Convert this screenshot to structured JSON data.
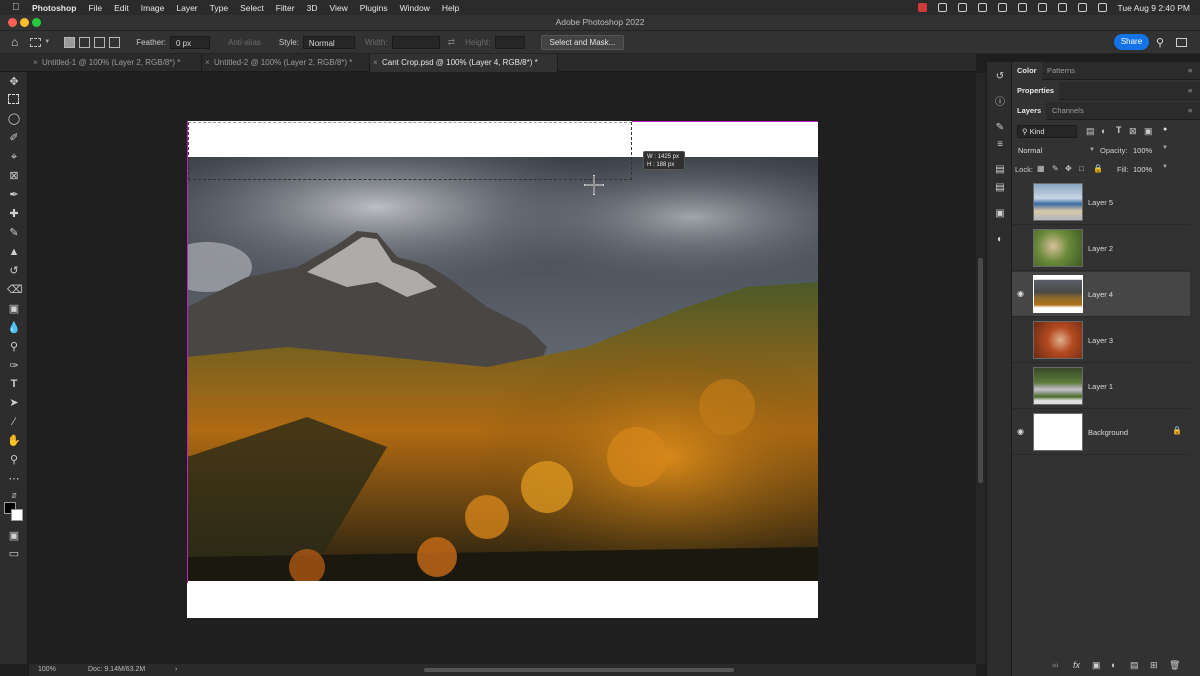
{
  "menubar": {
    "app": "Photoshop",
    "items": [
      "File",
      "Edit",
      "Image",
      "Layer",
      "Type",
      "Select",
      "Filter",
      "3D",
      "View",
      "Plugins",
      "Window",
      "Help"
    ],
    "clock": "Tue Aug 9  2:40 PM"
  },
  "window": {
    "title": "Adobe Photoshop 2022"
  },
  "options": {
    "feather_label": "Feather:",
    "feather_value": "0 px",
    "antialias_label": "Anti-alias",
    "style_label": "Style:",
    "style_value": "Normal",
    "width_label": "Width:",
    "height_label": "Height:",
    "mask_button": "Select and Mask...",
    "share_button": "Share"
  },
  "tabs": [
    {
      "label": "Untitled-1 @ 100% (Layer 2, RGB/8*) *",
      "active": false
    },
    {
      "label": "Untitled-2 @ 100% (Layer 2, RGB/8*) *",
      "active": false
    },
    {
      "label": "Cant Crop.psd @ 100% (Layer 4, RGB/8*) *",
      "active": true
    }
  ],
  "selection_readout": {
    "w": "W : 1425 px",
    "h": "H :  188 px"
  },
  "status": {
    "zoom": "100%",
    "doc": "Doc: 9.14M/63.2M",
    "arrow": "›"
  },
  "panels": {
    "color_tabs": [
      "Color",
      "Patterns"
    ],
    "properties_tab": "Properties",
    "layers_tabs": [
      "Layers",
      "Channels"
    ],
    "filter_kind": "Kind",
    "blend_mode": "Normal",
    "opacity_label": "Opacity:",
    "opacity_value": "100%",
    "lock_label": "Lock:",
    "fill_label": "Fill:",
    "fill_value": "100%"
  },
  "layers": [
    {
      "name": "Layer 5",
      "visible": false,
      "selected": false
    },
    {
      "name": "Layer 2",
      "visible": false,
      "selected": false
    },
    {
      "name": "Layer 4",
      "visible": true,
      "selected": true
    },
    {
      "name": "Layer 3",
      "visible": false,
      "selected": false
    },
    {
      "name": "Layer 1",
      "visible": false,
      "selected": false
    },
    {
      "name": "Background",
      "visible": true,
      "selected": false,
      "locked": true
    }
  ],
  "colors": {
    "accent": "#1473e6",
    "artboard_guide": "#c020c0"
  }
}
